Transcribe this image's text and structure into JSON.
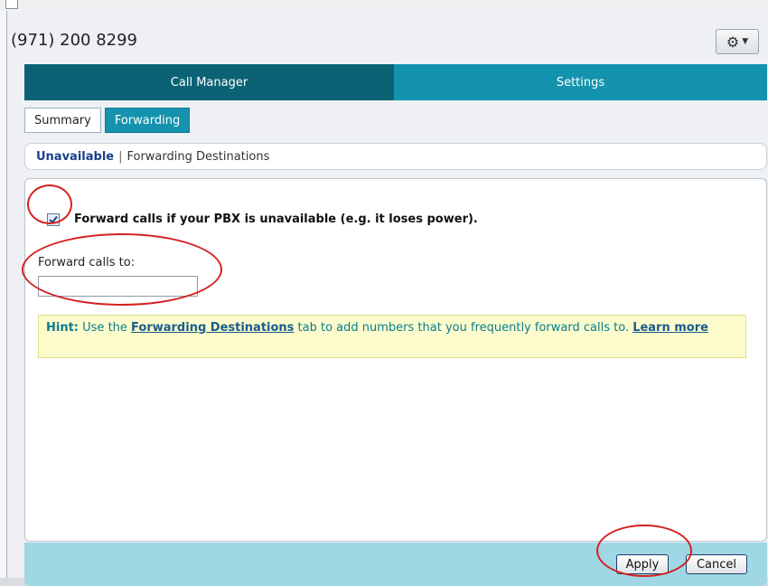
{
  "header": {
    "phone_number": "(971) 200 8299",
    "settings_menu_icon": "gear-icon"
  },
  "nav": {
    "tabs": [
      {
        "label": "Call Manager",
        "active": true
      },
      {
        "label": "Settings",
        "active": false
      }
    ]
  },
  "subtabs": [
    {
      "label": "Summary",
      "active": false
    },
    {
      "label": "Forwarding",
      "active": true
    }
  ],
  "breadcrumb": {
    "active": "Unavailable",
    "separator": "|",
    "link": "Forwarding Destinations"
  },
  "form": {
    "forward_checkbox": {
      "checked": true,
      "label": "Forward calls if your PBX is unavailable (e.g. it loses power)."
    },
    "forward_to_label": "Forward calls to:",
    "forward_to_value": "",
    "hint": {
      "prefix": "Hint:",
      "text_before": " Use the ",
      "link": "Forwarding Destinations",
      "text_after": " tab to add numbers that you frequently forward calls to. ",
      "learn_more": "Learn more"
    }
  },
  "footer": {
    "apply_label": "Apply",
    "cancel_label": "Cancel"
  },
  "colors": {
    "nav_active": "#0b6275",
    "nav_inactive": "#1393ad",
    "annotation": "#d42020"
  }
}
